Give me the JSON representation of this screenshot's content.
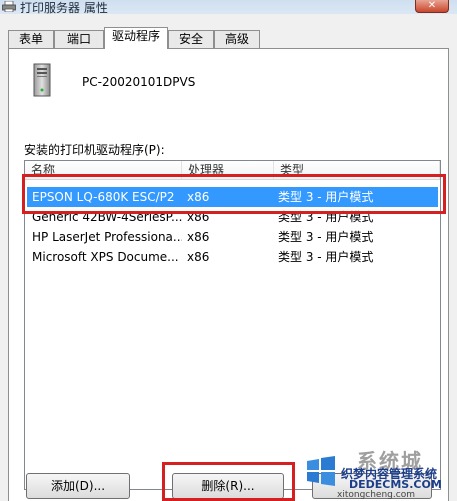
{
  "window": {
    "title": "打印服务器 属性",
    "close_glyph": "✕"
  },
  "tabs": [
    {
      "label": "表单",
      "active": false
    },
    {
      "label": "端口",
      "active": false
    },
    {
      "label": "驱动程序",
      "active": true
    },
    {
      "label": "安全",
      "active": false
    },
    {
      "label": "高级",
      "active": false
    }
  ],
  "server": {
    "name": "PC-20020101DPVS",
    "icon": "server-tower-icon"
  },
  "drivers": {
    "label": "安装的打印机驱动程序(P):",
    "columns": [
      "名称",
      "处理器",
      "类型"
    ],
    "rows": [
      {
        "name": "EPSON LQ-680K ESC/P2",
        "processor": "x86",
        "type": "类型 3 - 用户模式",
        "selected": true
      },
      {
        "name": "Generic 42BW-4SeriesP...",
        "processor": "x86",
        "type": "类型 3 - 用户模式",
        "selected": false
      },
      {
        "name": "HP LaserJet Professiona...",
        "processor": "x86",
        "type": "类型 3 - 用户模式",
        "selected": false
      },
      {
        "name": "Microsoft XPS Docume...",
        "processor": "x86",
        "type": "类型 3 - 用户模式",
        "selected": false
      }
    ]
  },
  "buttons": {
    "add": "添加(D)...",
    "delete": "删除(R)..."
  },
  "watermark": {
    "big": "系统城",
    "line1": "织梦内容管理系统",
    "line2": "DEDECMS.COM",
    "line3": "xitongcheng.com"
  },
  "colors": {
    "selection": "#3399ff",
    "highlight_box": "#d42020"
  }
}
